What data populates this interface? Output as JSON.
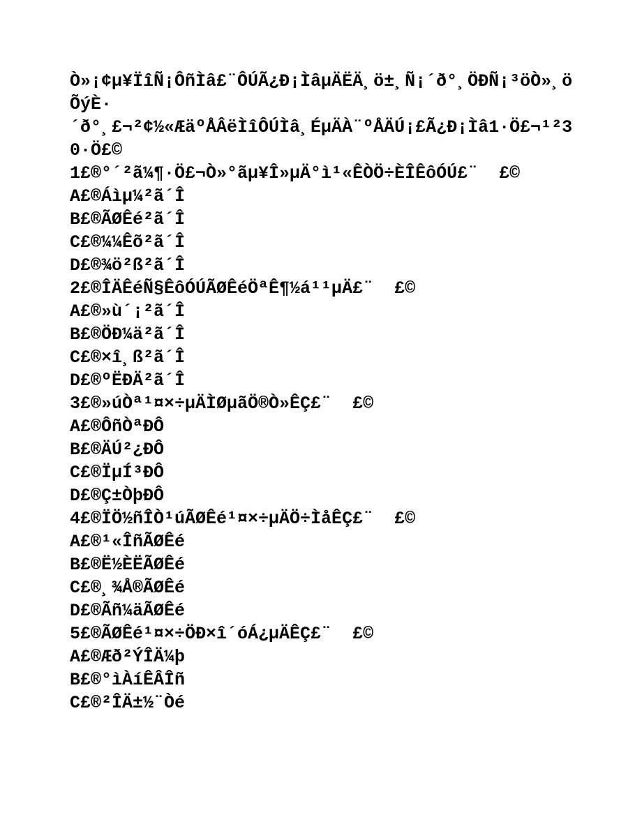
{
  "doc": {
    "intro": "Ò»¡¢µ¥ÏîÑ¡ÔñÌâ£¨ÔÚÃ¿Ð¡ÌâµÄËÄ¸ö±¸Ñ¡´ð°¸ÖÐÑ¡³öÒ»¸öÕýÈ·´ð°¸£¬²¢½«ÆäºÅÂëÌîÔÚÌâ¸ÉµÄÀ¨ºÅÄÚ¡£Ã¿Ð¡Ìâ1·Ö£¬¹²30·Ö£©",
    "questions": [
      {
        "stem": "1£®°´²ã¼¶·Ö£¬Ò»°ãµ¥Î»µÄ°ì¹«ÊÒÖ÷ÈÎÊôÓÚ£¨  £©",
        "options": [
          "A£®Áìµ¼²ã´Î",
          "B£®ÃØÊé²ã´Î",
          "C£®¼¼Êõ²ã´Î",
          "D£®¾ö²ß²ã´Î"
        ]
      },
      {
        "stem": "2£®ÎÄÊéÑ§ÊôÓÚÃØÊéÖªÊ¶½á¹¹µÄ£¨  £©",
        "options": [
          "A£®»ù´¡²ã´Î",
          "B£®ÖÐ¼ä²ã´Î",
          "C£®×î¸ß²ã´Î",
          "D£®ºËÐÄ²ã´Î"
        ]
      },
      {
        "stem": "3£®»úÒª¹¤×÷µÄÌØµãÖ®Ò»ÊÇ£¨  £©",
        "options": [
          "A£®ÔñÒªÐÔ",
          "B£®ÄÚ²¿ÐÔ",
          "C£®ÏµÍ³ÐÔ",
          "D£®Ç±ÒþÐÔ"
        ]
      },
      {
        "stem": "4£®ÏÖ½ñÎÒ¹úÃØÊé¹¤×÷µÄÖ÷ÌåÊÇ£¨  £©",
        "options": [
          "A£®¹«ÎñÃØÊé",
          "B£®Ë½ÈËÃØÊé",
          "C£®¸¾Å®ÃØÊé",
          "D£®Ãñ¼äÃØÊé"
        ]
      },
      {
        "stem": "5£®ÃØÊé¹¤×÷ÖÐ×î´óÁ¿µÄÊÇ£¨  £©",
        "options": [
          "A£®Æð²ÝÎÄ¼þ",
          "B£®°ìÀíÊÂÎñ",
          "C£®²ÎÄ±½¨Òé"
        ]
      }
    ]
  }
}
